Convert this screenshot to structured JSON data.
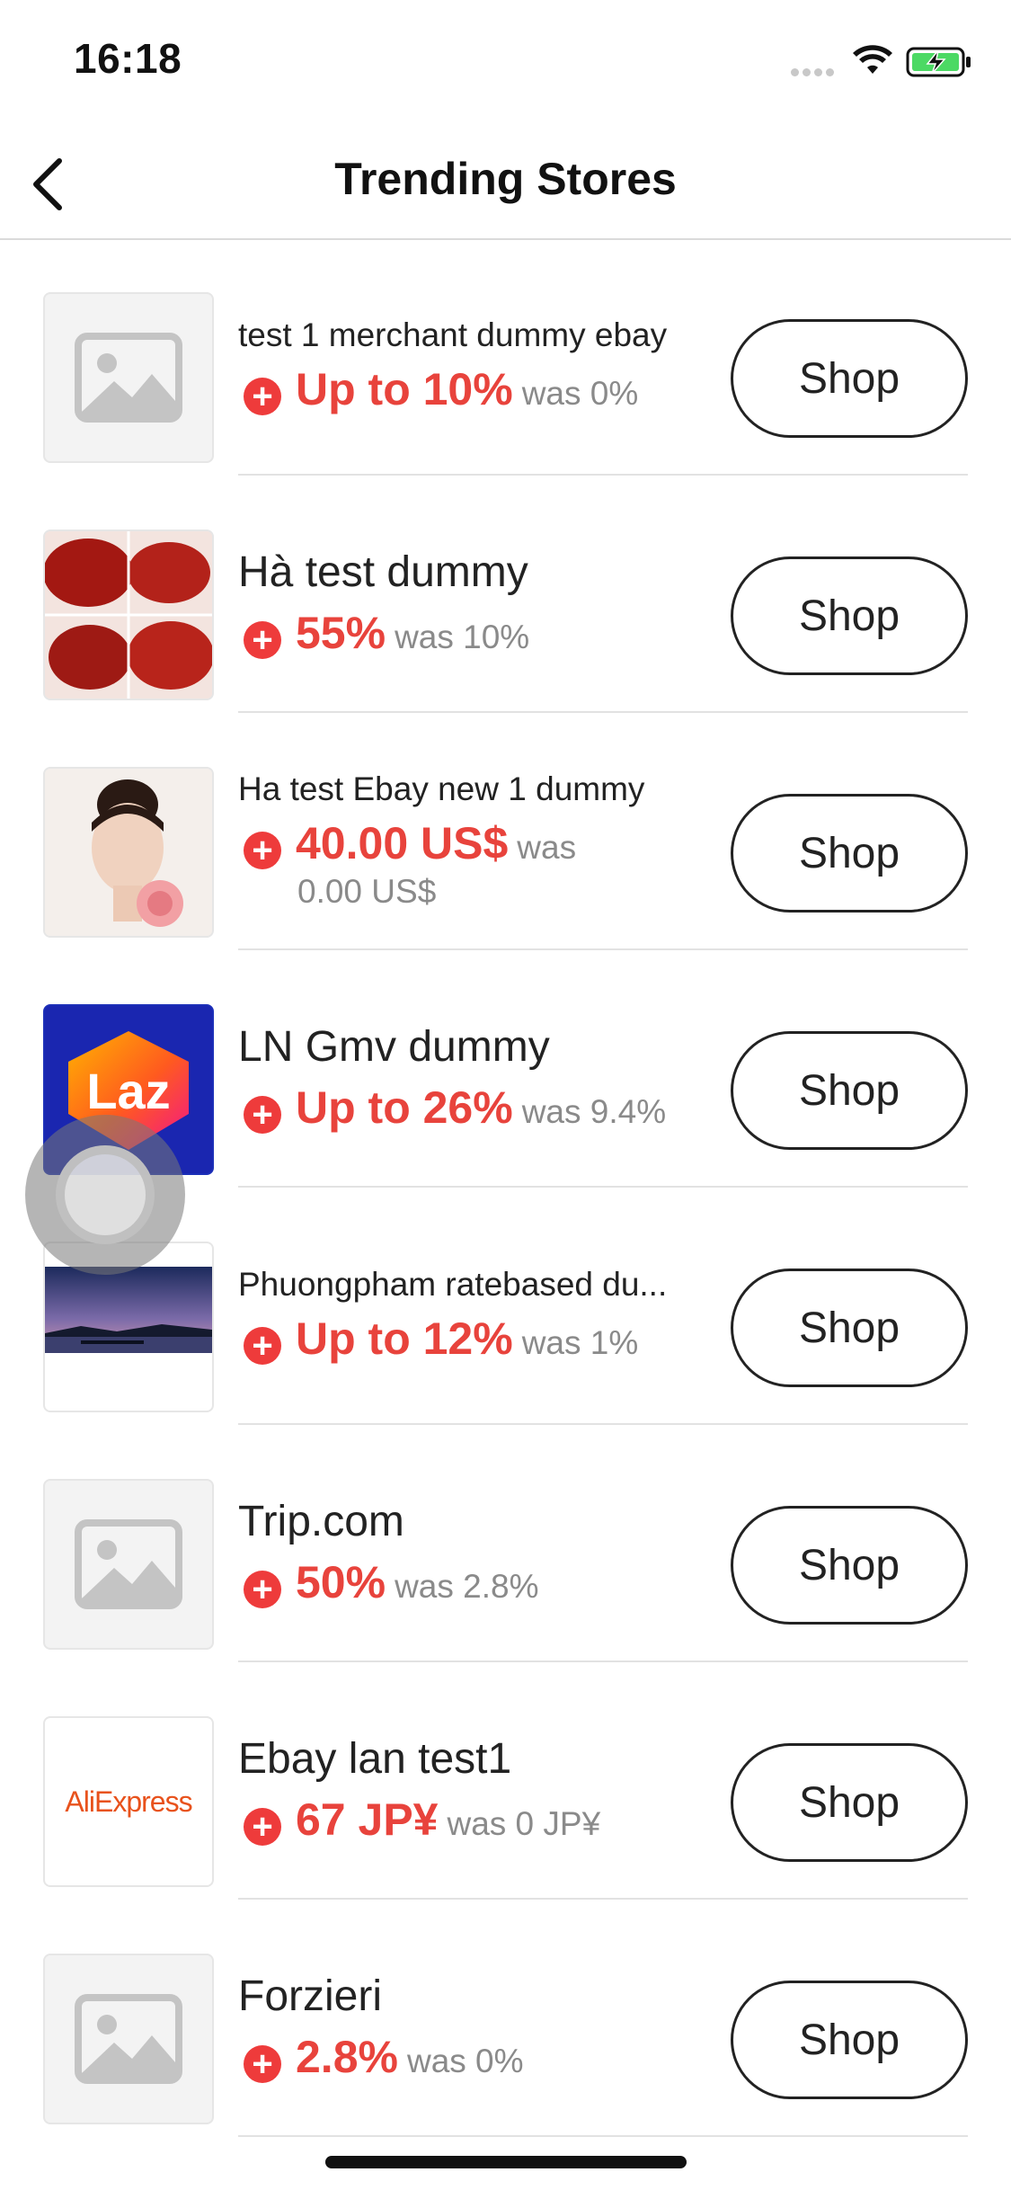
{
  "status_bar": {
    "time": "16:18"
  },
  "nav": {
    "title": "Trending Stores"
  },
  "stores": [
    {
      "name": "test 1 merchant dummy ebay",
      "rate": "Up to 10%",
      "was": "was 0%",
      "logo": "placeholder",
      "shop_label": "Shop"
    },
    {
      "name": "Hà test dummy",
      "rate": "55%",
      "was": "was 10%",
      "logo": "lipstick-swatches",
      "shop_label": "Shop"
    },
    {
      "name": "Ha test Ebay new 1 dummy",
      "rate": "40.00 US$",
      "was": "was",
      "was_cont": "0.00 US$",
      "logo": "portrait-photo",
      "shop_label": "Shop"
    },
    {
      "name": "LN Gmv dummy",
      "rate": "Up to 26%",
      "was": "was 9.4%",
      "logo": "lazada-logo",
      "logo_text": "Laz",
      "shop_label": "Shop"
    },
    {
      "name": "Phuongpham ratebased du...",
      "rate": "Up to 12%",
      "was": "was 1%",
      "logo": "sunset-lake-photo",
      "shop_label": "Shop"
    },
    {
      "name": "Trip.com",
      "rate": "50%",
      "was": "was 2.8%",
      "logo": "placeholder",
      "shop_label": "Shop"
    },
    {
      "name": "Ebay lan test1",
      "rate": "67 JP¥",
      "was": "was 0 JP¥",
      "logo": "aliexpress-logo",
      "logo_text": "AliExpress",
      "shop_label": "Shop"
    },
    {
      "name": "Forzieri",
      "rate": "2.8%",
      "was": "was 0%",
      "logo": "placeholder",
      "shop_label": "Shop"
    }
  ],
  "colors": {
    "accent": "#e8433c",
    "battery": "#4cd964"
  },
  "icons": {
    "back": "chevron-left-icon",
    "plus": "plus-circle-icon",
    "placeholder": "image-placeholder-icon"
  }
}
